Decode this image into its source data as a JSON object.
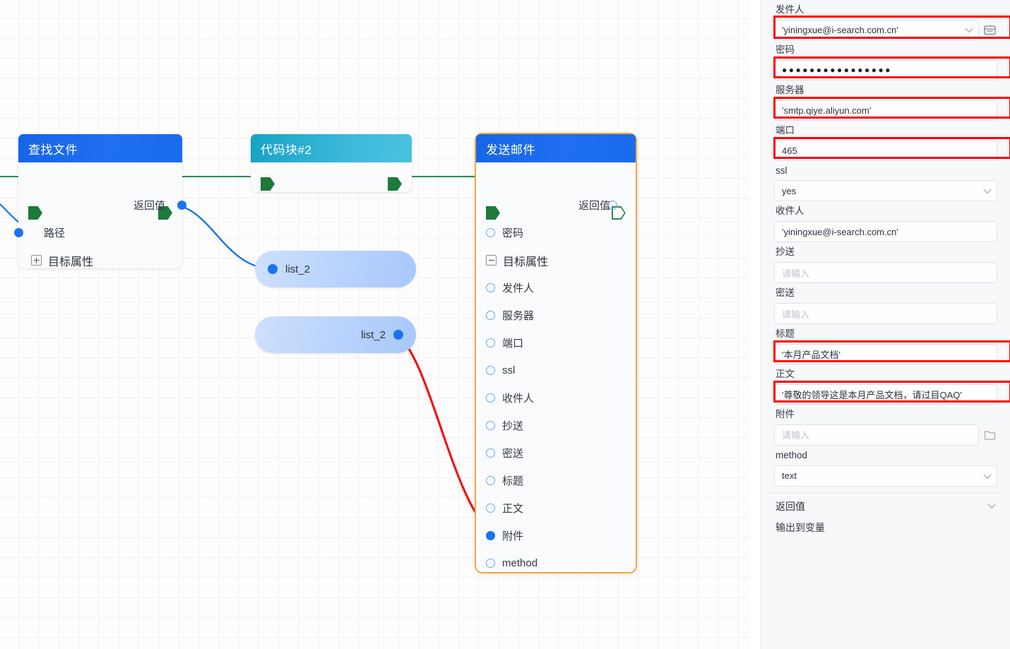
{
  "canvas": {
    "nodes": [
      {
        "id": "find-file",
        "title": "查找文件",
        "rows": [
          {
            "label": "返回值",
            "side": "out",
            "port": "filled"
          },
          {
            "label": "路径",
            "side": "in",
            "port": "filled"
          },
          {
            "label": "目标属性",
            "side": "tree",
            "icon": "plus"
          }
        ]
      },
      {
        "id": "code-block",
        "title": "代码块#2",
        "rows": []
      },
      {
        "id": "send-mail",
        "title": "发送邮件",
        "rows": [
          {
            "label": "返回值",
            "side": "out",
            "port": "hollow"
          },
          {
            "label": "密码",
            "side": "in",
            "port": "hollow"
          },
          {
            "label": "目标属性",
            "side": "tree",
            "icon": "minus"
          },
          {
            "label": "发件人",
            "side": "in",
            "port": "hollow"
          },
          {
            "label": "服务器",
            "side": "in",
            "port": "hollow"
          },
          {
            "label": "端口",
            "side": "in",
            "port": "hollow"
          },
          {
            "label": "ssl",
            "side": "in",
            "port": "hollow"
          },
          {
            "label": "收件人",
            "side": "in",
            "port": "hollow"
          },
          {
            "label": "抄送",
            "side": "in",
            "port": "hollow"
          },
          {
            "label": "密送",
            "side": "in",
            "port": "hollow"
          },
          {
            "label": "标题",
            "side": "in",
            "port": "hollow"
          },
          {
            "label": "正文",
            "side": "in",
            "port": "hollow"
          },
          {
            "label": "附件",
            "side": "in",
            "port": "filled"
          },
          {
            "label": "method",
            "side": "in",
            "port": "hollow"
          }
        ]
      }
    ],
    "pills": [
      {
        "id": "pill-top",
        "label": "list_2"
      },
      {
        "id": "pill-bottom",
        "label": "list_2"
      }
    ],
    "colors": {
      "flow_wire": "#2e8b4f",
      "data_wire_blue": "#1a73f0",
      "data_wire_red": "#fb0000",
      "node_header_blue": "#1f6ff0",
      "node_header_cyan": "#3cb9da",
      "selection_border": "#f0a93c"
    }
  },
  "panel": {
    "fields": [
      {
        "id": "sender",
        "label": "发件人",
        "type": "select-with-button",
        "value": "'yiningxue@i-search.com.cn'",
        "button_icon": "folder-icon",
        "highlighted": true
      },
      {
        "id": "password",
        "label": "密码",
        "type": "password",
        "value": "●●●●●●●●●●●●●●●●",
        "highlighted": true
      },
      {
        "id": "server",
        "label": "服务器",
        "type": "text",
        "value": "'smtp.qiye.aliyun.com'",
        "highlighted": true
      },
      {
        "id": "port",
        "label": "端口",
        "type": "text",
        "value": "465",
        "highlighted": true
      },
      {
        "id": "ssl",
        "label": "ssl",
        "type": "select",
        "value": "yes",
        "highlighted": false
      },
      {
        "id": "recipient",
        "label": "收件人",
        "type": "text",
        "value": "'yiningxue@i-search.com.cn'",
        "highlighted": false
      },
      {
        "id": "cc",
        "label": "抄送",
        "type": "text",
        "value": "",
        "placeholder": "请输入",
        "highlighted": false
      },
      {
        "id": "bcc",
        "label": "密送",
        "type": "text",
        "value": "",
        "placeholder": "请输入",
        "highlighted": false
      },
      {
        "id": "subject",
        "label": "标题",
        "type": "text",
        "value": "'本月产品文档'",
        "highlighted": true
      },
      {
        "id": "body",
        "label": "正文",
        "type": "text",
        "value": "'尊敬的领导这是本月产品文档，请过目QAQ'",
        "highlighted": true
      },
      {
        "id": "attachment",
        "label": "附件",
        "type": "text-with-button",
        "value": "",
        "placeholder": "请输入",
        "button_icon": "folder-icon",
        "highlighted": false
      },
      {
        "id": "method",
        "label": "method",
        "type": "select",
        "value": "text",
        "highlighted": false
      }
    ],
    "section_return": {
      "label": "返回值",
      "caret": "chevron-down-icon"
    },
    "output_label": "输出到变量"
  }
}
